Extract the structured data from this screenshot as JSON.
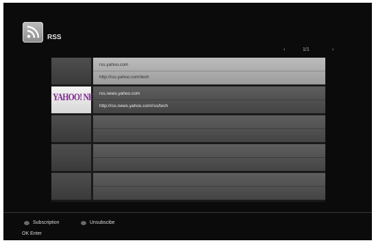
{
  "header": {
    "title": "RSS",
    "logo_icon": "rss-feed-icon"
  },
  "pager": {
    "prev_symbol": "‹",
    "page": "1/1",
    "next_symbol": "›"
  },
  "feeds": [
    {
      "line1": "rss.yahoo.com",
      "line2": "http://rss.yahoo.com/tech",
      "selected": true,
      "thumbnail": "none"
    },
    {
      "line1": "rss.news.yahoo.com",
      "line2": "http://rss.news.yahoo.com/rss/tech",
      "selected": false,
      "thumbnail": "YAHOO! NEWS",
      "thumbnail_brand_color": "#7a2a8a"
    }
  ],
  "empty_rows": 3,
  "footer": {
    "subscription_label": "Subscription",
    "unsubscribe_label": "Unsubscibe",
    "ok_label": "OK Enter"
  },
  "colors": {
    "background": "#0b0b0b",
    "selected_row": "#bcbcbc",
    "normal_row": "#545454"
  }
}
